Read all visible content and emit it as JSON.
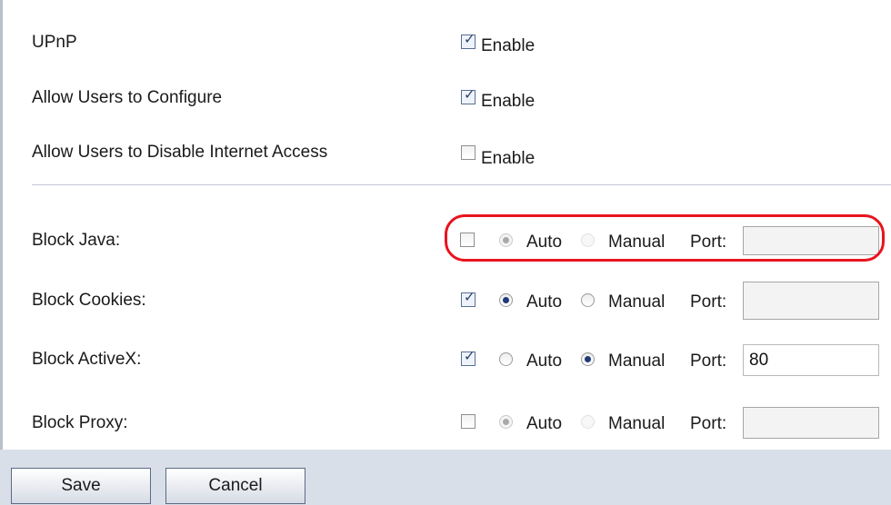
{
  "settings": [
    {
      "label": "UPnP",
      "checked": true,
      "option": "Enable"
    },
    {
      "label": "Allow Users to Configure",
      "checked": true,
      "option": "Enable"
    },
    {
      "label": "Allow Users to Disable Internet Access",
      "checked": false,
      "option": "Enable"
    }
  ],
  "blocks": [
    {
      "label": "Block Java:",
      "checked": false,
      "mode": "Auto",
      "port": ""
    },
    {
      "label": "Block Cookies:",
      "checked": true,
      "mode": "Auto",
      "port": ""
    },
    {
      "label": "Block ActiveX:",
      "checked": true,
      "mode": "Manual",
      "port": "80"
    },
    {
      "label": "Block Proxy:",
      "checked": false,
      "mode": "Auto",
      "port": ""
    }
  ],
  "options": {
    "auto": "Auto",
    "manual": "Manual",
    "port": "Port:"
  },
  "buttons": {
    "save": "Save",
    "cancel": "Cancel"
  },
  "colors": {
    "highlight": "#e8141e",
    "footer": "#d9dfe9"
  }
}
